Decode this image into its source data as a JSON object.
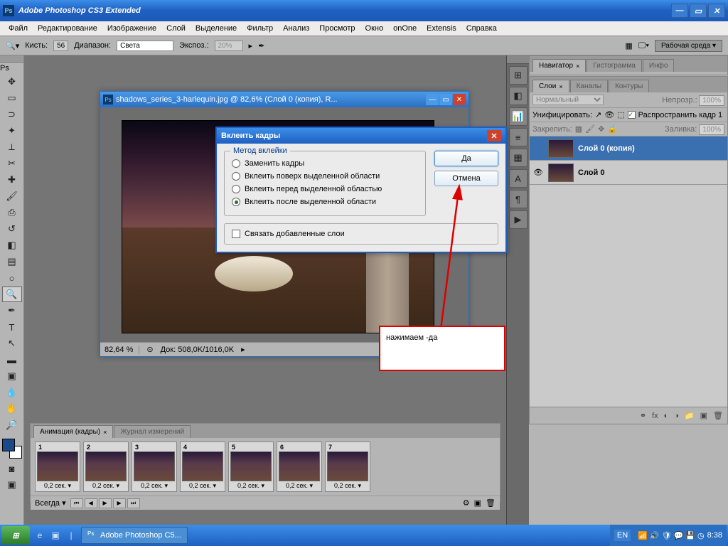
{
  "app": {
    "title": "Adobe Photoshop CS3 Extended",
    "icon_label": "Ps"
  },
  "menu": [
    "Файл",
    "Редактирование",
    "Изображение",
    "Слой",
    "Выделение",
    "Фильтр",
    "Анализ",
    "Просмотр",
    "Окно",
    "onOne",
    "Extensis",
    "Справка"
  ],
  "options": {
    "brush_label": "Кисть:",
    "brush_size": "56",
    "range_label": "Диапазон:",
    "range_value": "Света",
    "expo_label": "Экспоз.:",
    "expo_value": "20%",
    "workspace": "Рабочая среда ▾"
  },
  "document": {
    "title": "shadows_series_3-harlequin.jpg @ 82,6% (Слой 0 (копия), R...",
    "zoom": "82,64 %",
    "doc_info": "Док: 508,0K/1016,0K"
  },
  "dialog": {
    "title": "Вклеить кадры",
    "group_label": "Метод вклейки",
    "opts": [
      "Заменить кадры",
      "Вклеить поверх выделенной области",
      "Вклеить перед выделенной областью",
      "Вклеить после выделенной области"
    ],
    "selected": 3,
    "link_label": "Связать добавленные слои",
    "yes": "Да",
    "cancel": "Отмена"
  },
  "annotation": "нажимаем -да",
  "right": {
    "nav_tabs": [
      "Навигатор",
      "Гистограмма",
      "Инфо"
    ],
    "layer_tabs": [
      "Слои",
      "Каналы",
      "Контуры"
    ],
    "blend": "Нормальный",
    "opacity_label": "Непрозр.:",
    "opacity": "100%",
    "unify_label": "Унифицировать:",
    "propagate_label": "Распространить кадр 1",
    "lock_label": "Закрепить:",
    "fill_label": "Заливка:",
    "fill": "100%",
    "layers": [
      {
        "name": "Слой 0 (копия)",
        "visible": false,
        "selected": true
      },
      {
        "name": "Слой 0",
        "visible": true,
        "selected": false
      }
    ]
  },
  "animation": {
    "tabs": [
      "Анимация (кадры)",
      "Журнал измерений"
    ],
    "frames": [
      {
        "n": "1",
        "d": "0,2 сек. ▾"
      },
      {
        "n": "2",
        "d": "0,2 сек. ▾"
      },
      {
        "n": "3",
        "d": "0,2 сек. ▾"
      },
      {
        "n": "4",
        "d": "0,2 сек. ▾"
      },
      {
        "n": "5",
        "d": "0,2 сек. ▾"
      },
      {
        "n": "6",
        "d": "0,2 сек. ▾"
      },
      {
        "n": "7",
        "d": "0,2 сек. ▾"
      }
    ],
    "loop": "Всегда ▾"
  },
  "taskbar": {
    "task": "Adobe Photoshop C5...",
    "lang": "EN",
    "time": "8:38"
  }
}
